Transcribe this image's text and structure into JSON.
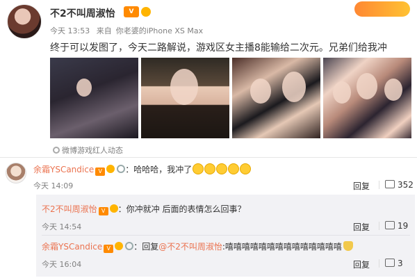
{
  "post": {
    "username": "不2不叫周淑怡",
    "vip_label": "V",
    "time": "今天 13:53",
    "source_prefix": "来自",
    "source": "你老婆的iPhone XS Max",
    "badge_top_right": "",
    "text": "终于可以发图了，今天二路解说，游戏区女主播8能输给二次元。兄弟们给我冲",
    "photos_count": 4,
    "tag": "微博游戏红人动态"
  },
  "comments": [
    {
      "name": "余霜YSCandice",
      "vip": "V",
      "text": "：哈哈哈，我冲了",
      "emoji_count": 5,
      "time": "今天 14:09",
      "reply_label": "回复",
      "likes": "352"
    }
  ],
  "replies": [
    {
      "name": "不2不叫周淑怡",
      "vip": "V",
      "text": "：你冲就冲 后面的表情怎么回事？",
      "time": "今天 14:54",
      "reply_label": "回复",
      "likes": "19"
    },
    {
      "name": "余霜YSCandice",
      "vip": "V",
      "text_prefix": "：回复",
      "mention": "@不2不叫周淑怡",
      "text": ":嘻嘻嘻嘻嘻嘻嘻嘻嘻嘻嘻嘻嘻嘻",
      "time": "今天 16:04",
      "reply_label": "回复",
      "likes": "3"
    }
  ],
  "colors": {
    "name_accent": "#eb7350",
    "meta_gray": "#808080",
    "reply_bg": "#f2f2f5",
    "vip_orange": "#ff8a00"
  }
}
